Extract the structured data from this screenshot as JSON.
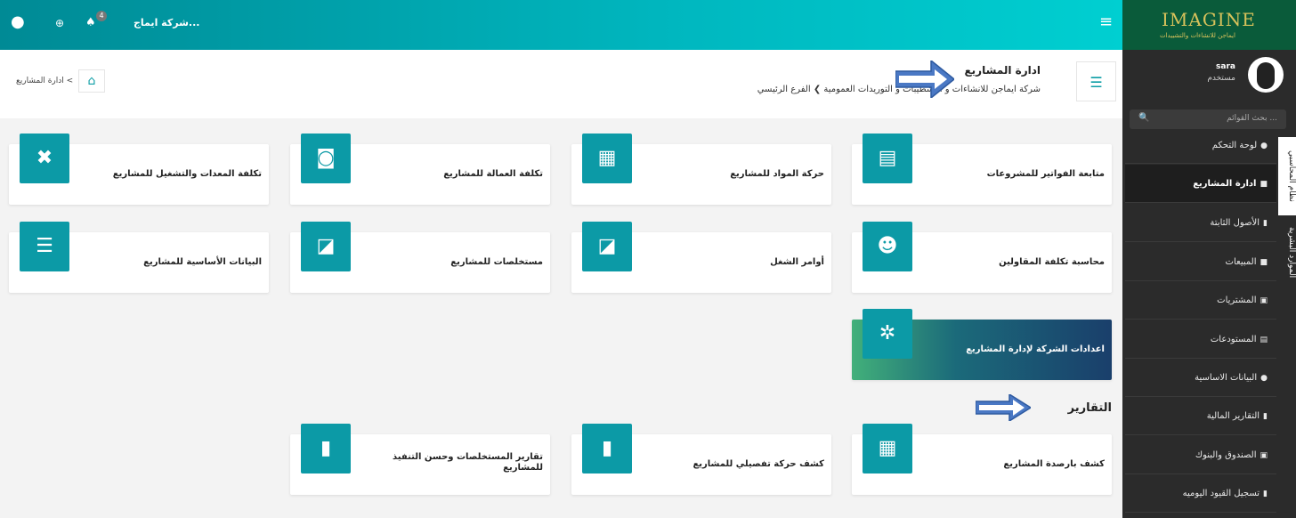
{
  "topbar": {
    "company": "شركة ايماج...",
    "notif_count": "4",
    "user_icon": "user-icon",
    "globe_icon": "globe-icon",
    "bell_icon": "bell-icon",
    "menu_icon": "hamburger-icon"
  },
  "logo": {
    "text": "IMAGINE",
    "sub": "ايماجن للانشاءات والتشييدات"
  },
  "sidebar": {
    "user_name": "sara",
    "user_role": "مستخدم",
    "search_placeholder": "بحث القوائم ...",
    "vtab1": "نظام المحاسبي",
    "vtab2": "الموارد البشرية",
    "items": [
      {
        "label": "لوحة التحكم",
        "icon": "info-icon"
      },
      {
        "label": "ادارة المشاريع",
        "icon": "briefcase-icon"
      },
      {
        "label": "الأصول الثابتة",
        "icon": "file-icon"
      },
      {
        "label": "المبيعات",
        "icon": "truck-icon"
      },
      {
        "label": "المشتريات",
        "icon": "money-icon"
      },
      {
        "label": "المستودعات",
        "icon": "archive-icon"
      },
      {
        "label": "البيانات الاساسية",
        "icon": "info-icon"
      },
      {
        "label": "التقارير المالية",
        "icon": "file-icon"
      },
      {
        "label": "الصندوق والبنوك",
        "icon": "money-icon"
      },
      {
        "label": "تسجيل القيود اليوميه",
        "icon": "file-icon"
      }
    ]
  },
  "header": {
    "title": "ادارة المشاريع",
    "subtitle": "شركة ايماجن للانشاءات و التشطيبات و التوريدات العمومية  ❯  الفرع الرئيسي",
    "breadcrumb": "ادارة المشاريع"
  },
  "cards": [
    {
      "label": "متابعة الفواتير للمشروعات",
      "icon": "invoice-icon",
      "glyph": "▤"
    },
    {
      "label": "حركة المواد للمشاريع",
      "icon": "building-icon",
      "glyph": "▦"
    },
    {
      "label": "تكلفة العمالة للمشاريع",
      "icon": "briefcase-clock-icon",
      "glyph": "◙"
    },
    {
      "label": "تكلفة المعدات والتشغيل للمشاريع",
      "icon": "tools-icon",
      "glyph": "✖"
    },
    {
      "label": "محاسبة تكلفة المقاولين",
      "icon": "users-icon",
      "glyph": "☻"
    },
    {
      "label": "أوامر الشغل",
      "icon": "sticky-note-icon",
      "glyph": "◪"
    },
    {
      "label": "مستخلصات للمشاريع",
      "icon": "sticky-note-icon",
      "glyph": "◪"
    },
    {
      "label": "البيانات الأساسية للمشاريع",
      "icon": "database-icon",
      "glyph": "☰"
    },
    {
      "label": "اعدادات الشركة لإدارة المشاريع",
      "icon": "gear-icon",
      "glyph": "✲"
    }
  ],
  "reports_title": "التقارير",
  "reports": [
    {
      "label": "كشف بارصدة المشاريع",
      "icon": "calculator-icon",
      "glyph": "▦"
    },
    {
      "label": "كشف حركة تفصيلي للمشاريع",
      "icon": "file-icon",
      "glyph": "▮"
    },
    {
      "label": "تقارير المستخلصات وحسن التنفيذ للمشاريع",
      "icon": "file-icon",
      "glyph": "▮"
    }
  ]
}
